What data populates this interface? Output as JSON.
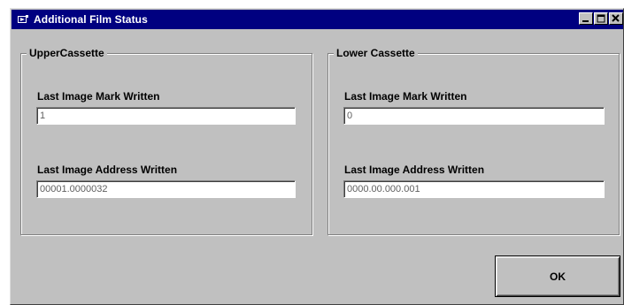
{
  "window": {
    "title": "Additional Film Status",
    "icon": "film-app-icon",
    "controls": [
      "minimize-icon",
      "maximize-icon",
      "close-icon"
    ]
  },
  "upper_cassette": {
    "group_label": "UpperCassette",
    "mark_label": "Last Image Mark Written",
    "mark_value": "1",
    "address_label": "Last Image Address Written",
    "address_value": "00001.0000032"
  },
  "lower_cassette": {
    "group_label": "Lower Cassette",
    "mark_label": "Last Image Mark Written",
    "mark_value": "0",
    "address_label": "Last Image Address Written",
    "address_value": "0000.00.000.001"
  },
  "actions": {
    "ok_label": "OK"
  },
  "colors": {
    "titlebar": "#000080",
    "face": "#c0c0c0",
    "field_background": "#ffffff"
  }
}
